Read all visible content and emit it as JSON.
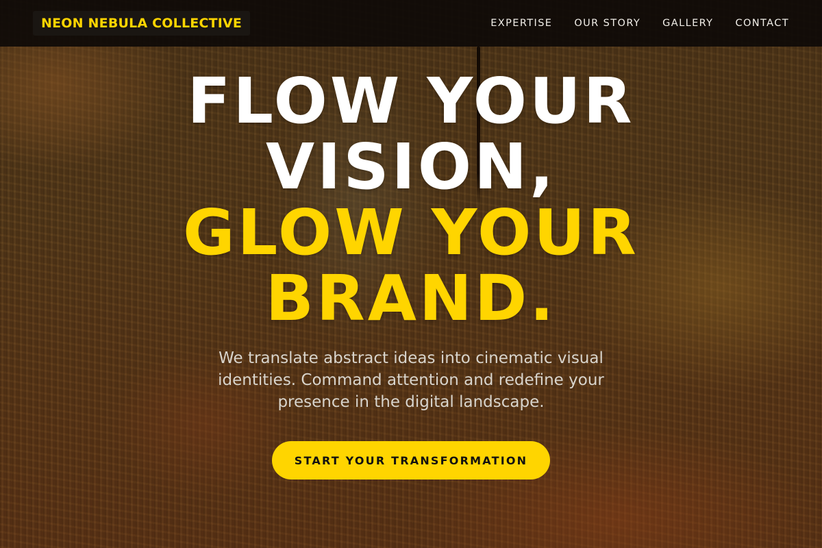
{
  "brand": {
    "name": "NEON NEBULA COLLECTIVE",
    "accent": "#FFD500"
  },
  "nav": {
    "links": [
      "EXPERTISE",
      "OUR STORY",
      "GALLERY",
      "CONTACT"
    ]
  },
  "hero": {
    "headline_lines": [
      "FLOW YOUR",
      "VISION,",
      "GLOW YOUR",
      "BRAND."
    ],
    "subtext": "We translate abstract ideas into cinematic visual identities. Command attention and redefine your presence in the digital landscape.",
    "cta_label": "START YOUR TRANSFORMATION"
  }
}
